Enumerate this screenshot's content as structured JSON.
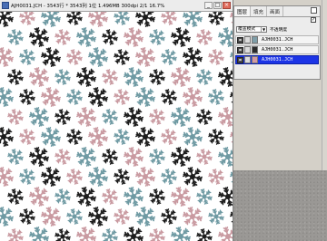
{
  "document": {
    "title": "AJH0031.JCH - 3543行 * 3543列 1位 1.496MB 300dpi 2/1 16.7%",
    "window_buttons": [
      "_",
      "□",
      "×"
    ]
  },
  "layers_panel": {
    "tabs": [
      "图层",
      "填充",
      "画面"
    ],
    "blend_mode": "覆盖模式",
    "opacity_label": "不透明度",
    "layers": [
      {
        "name": "AJH0031.JCH",
        "swatch": "#7f9ea8",
        "selected": false
      },
      {
        "name": "AJH0031.JCH",
        "swatch": "#2b2b2b",
        "selected": false
      },
      {
        "name": "AJH0031.JCH",
        "swatch": "#d49aa3",
        "selected": true
      }
    ]
  },
  "colors": {
    "pink": "#c99aa1",
    "teal": "#6f9aa3",
    "black": "#1d1d1d",
    "selection": "#1c34e6"
  }
}
